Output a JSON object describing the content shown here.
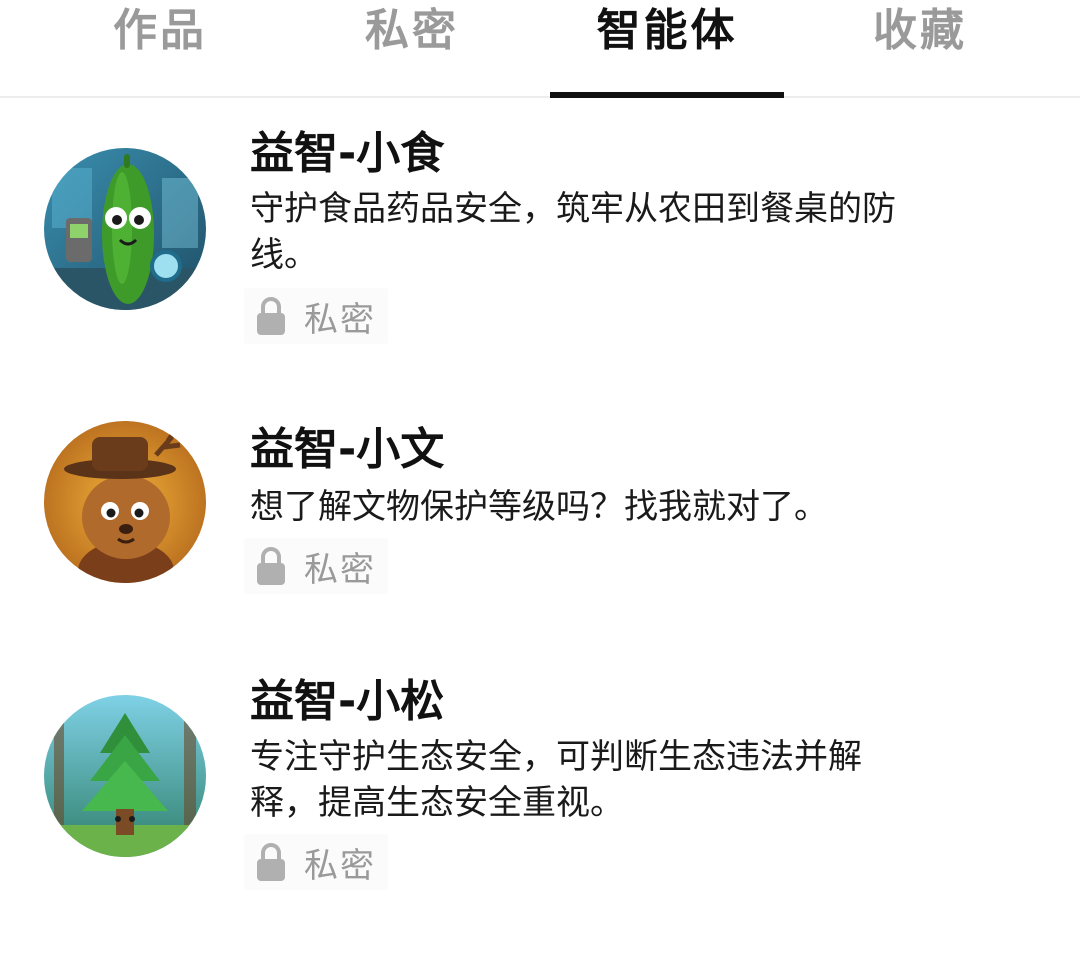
{
  "tabs": [
    {
      "label": "作品",
      "active": false
    },
    {
      "label": "私密",
      "active": false
    },
    {
      "label": "智能体",
      "active": true
    },
    {
      "label": "收藏",
      "active": false
    }
  ],
  "agents": [
    {
      "name": "益智-小食",
      "description": "守护食品药品安全，筑牢从农田到餐桌的防线。",
      "status": "私密",
      "avatar_icon": "cucumber-character-avatar"
    },
    {
      "name": "益智-小文",
      "description": "想了解文物保护等级吗？找我就对了。",
      "status": "私密",
      "avatar_icon": "deer-character-avatar"
    },
    {
      "name": "益智-小松",
      "description": "专注守护生态安全，可判断生态违法并解释，提高生态安全重视。",
      "status": "私密",
      "avatar_icon": "pine-tree-character-avatar"
    }
  ],
  "colors": {
    "active_tab": "#111111",
    "inactive_tab": "#9a9a9a",
    "muted_text": "#9a9a9a",
    "divider": "#ededed"
  }
}
